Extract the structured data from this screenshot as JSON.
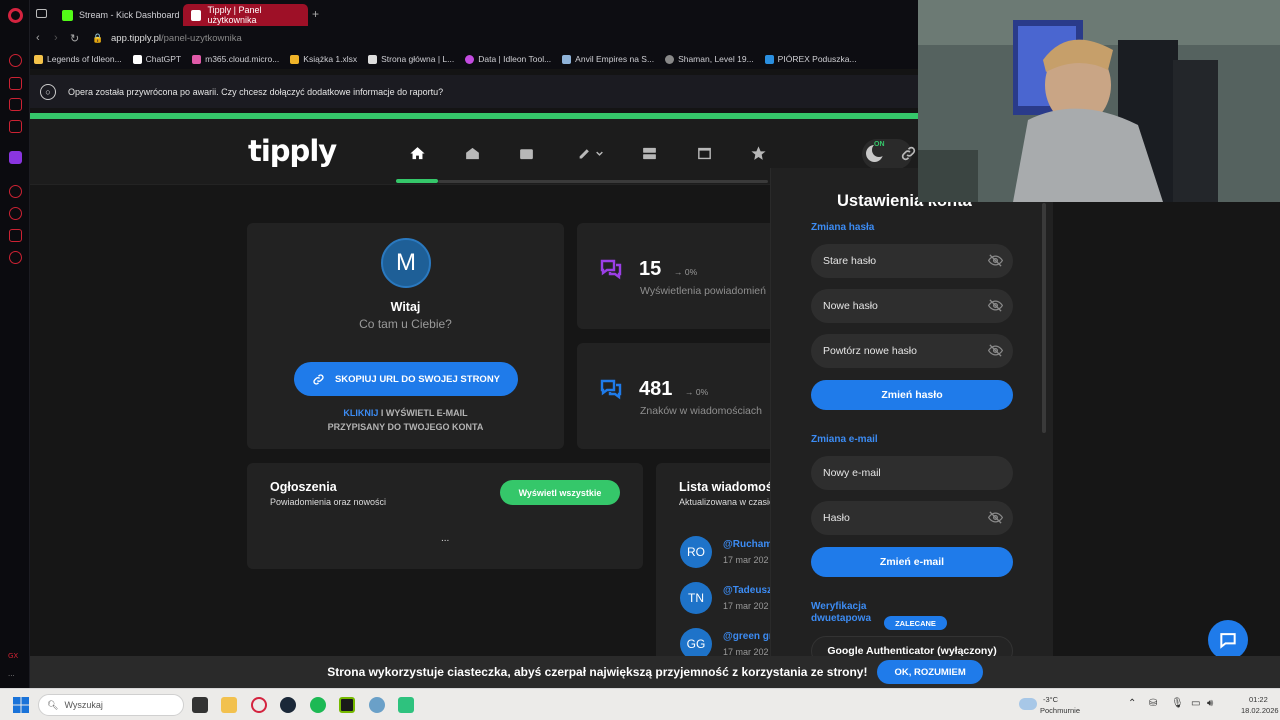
{
  "browser": {
    "tabs": [
      {
        "label": "Stream - Kick Dashboard",
        "favicon_color": "#53fc18"
      },
      {
        "label": "Tipply | Panel użytkownika",
        "favicon_color": "#ffffff",
        "active": true
      }
    ],
    "url_domain": "app.tipply.pl",
    "url_path": "/panel-uzytkownika",
    "bookmarks": [
      {
        "label": "Legends of Idleon...",
        "color": "#f4c24a"
      },
      {
        "label": "ChatGPT",
        "color": "#ffffff"
      },
      {
        "label": "m365.cloud.micro...",
        "color": "#e05aa8"
      },
      {
        "label": "Książka 1.xlsx",
        "color": "#f0b429"
      },
      {
        "label": "Strona główna | L...",
        "color": "#dddddd"
      },
      {
        "label": "Data | Idleon Tool...",
        "color": "#c34be0"
      },
      {
        "label": "Anvil Empires na S...",
        "color": "#8fb3d9"
      },
      {
        "label": "Shaman, Level 19...",
        "color": "#888888"
      },
      {
        "label": "PIÓREX Poduszka...",
        "color": "#2a8fe0"
      }
    ],
    "crash_notice": "Opera została przywrócona po awarii. Czy chcesz dołączyć dodatkowe informacje do raportu?",
    "sidebar_bottom_text": "GX"
  },
  "header": {
    "logo": "tipply",
    "toggle_label": "ON",
    "nav_icons": [
      "home-icon",
      "inbox-icon",
      "wallet-icon",
      "edit-icon",
      "server-icon",
      "window-icon",
      "star-icon"
    ]
  },
  "profile": {
    "avatar_letter": "M",
    "greeting": "Witaj",
    "subgreeting": "Co tam u Ciebie?",
    "copy_button": "SKOPIUJ URL DO SWOJEJ STRONY",
    "email_note_link": "KLIKNIJ",
    "email_note_rest": " I WYŚWIETL E-MAIL",
    "email_note_line2": "PRZYPISANY DO TWOJEGO KONTA"
  },
  "stats": [
    {
      "value": "15",
      "change": "→ 0%",
      "label": "Wyświetlenia powiadomień",
      "icon_color": "#9b3fe6"
    },
    {
      "value": "481",
      "change": "→ 0%",
      "label": "Znaków w wiadomościach",
      "icon_color": "#1f7bea"
    }
  ],
  "announcements": {
    "title": "Ogłoszenia",
    "subtitle": "Powiadomienia oraz nowości",
    "button": "Wyświetl wszystkie",
    "placeholder": "..."
  },
  "messages": {
    "title": "Lista wiadomości",
    "subtitle": "Aktualizowana w czasie",
    "items": [
      {
        "initials": "RO",
        "user": "@Rucham",
        "date": "17 mar 202"
      },
      {
        "initials": "TN",
        "user": "@Tadeusz",
        "date": "17 mar 202"
      },
      {
        "initials": "GG",
        "user": "@green gr",
        "date": "17 mar 202"
      }
    ]
  },
  "settings": {
    "title": "Ustawienia konta",
    "password_section": "Zmiana hasła",
    "old_password": "Stare hasło",
    "new_password": "Nowe hasło",
    "repeat_password": "Powtórz nowe hasło",
    "change_password_btn": "Zmień hasło",
    "email_section": "Zmiana e-mail",
    "new_email": "Nowy e-mail",
    "password": "Hasło",
    "change_email_btn": "Zmień e-mail",
    "twofa_line1": "Weryfikacja",
    "twofa_line2": "dwuetapowa",
    "recommended_badge": "ZALECANE",
    "google_auth": "Google Authenticator (wyłączony)"
  },
  "cookie": {
    "text": "Strona wykorzystuje ciasteczka, abyś czerpał największą przyjemność z korzystania ze strony!",
    "button": "OK, ROZUMIEM"
  },
  "taskbar": {
    "search_placeholder": "Wyszukaj",
    "weather_temp": "-3°C",
    "weather_desc": "Pochmurnie",
    "time": "01:22",
    "date": "18.02.2026"
  }
}
